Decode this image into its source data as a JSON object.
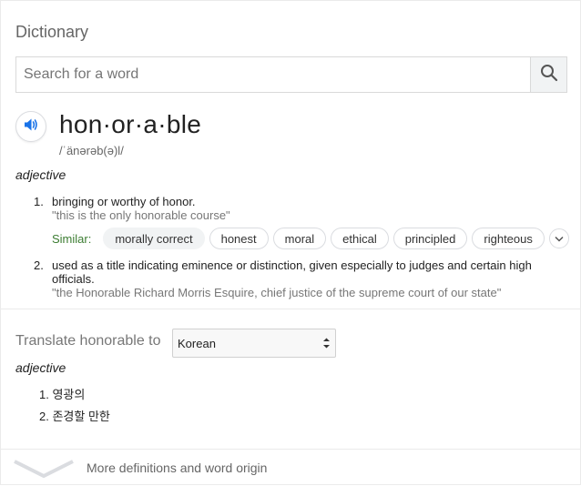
{
  "title": "Dictionary",
  "search": {
    "placeholder": "Search for a word",
    "value": ""
  },
  "entry": {
    "headword": "hon·or·a·ble",
    "phonetic": "/ˈänərəb(ə)l/",
    "part_of_speech": "adjective",
    "senses": [
      {
        "number": "1.",
        "definition": "bringing or worthy of honor.",
        "example": "\"this is the only honorable course\""
      },
      {
        "number": "2.",
        "definition": "used as a title indicating eminence or distinction, given especially to judges and certain high officials.",
        "example": "\"the Honorable Richard Morris Esquire, chief justice of the supreme court of our state\""
      }
    ],
    "similar": {
      "label": "Similar:",
      "words": [
        "morally correct",
        "honest",
        "moral",
        "ethical",
        "principled",
        "righteous"
      ]
    }
  },
  "translate": {
    "label": "Translate honorable to",
    "selected_language": "Korean",
    "part_of_speech": "adjective",
    "items": [
      {
        "number": "1.",
        "text": "영광의"
      },
      {
        "number": "2.",
        "text": "존경할 만한"
      }
    ]
  },
  "more": {
    "label": "More definitions and word origin"
  },
  "icons": {
    "search": "search-icon",
    "audio": "speaker-icon",
    "expand_similar": "chevron-down-icon",
    "select_arrows": "select-arrows-icon",
    "more": "chevron-down-icon"
  },
  "colors": {
    "accent": "#1a73e8",
    "similar_label": "#3c7d32",
    "muted": "#777777"
  }
}
